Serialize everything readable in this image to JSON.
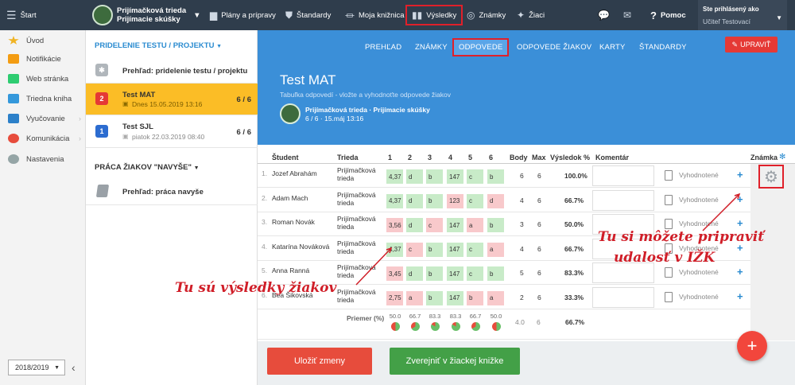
{
  "topbar": {
    "start": "Štart",
    "class_name": "Prijímačková trieda",
    "class_sub": "Prijímacie skúšky",
    "menu": [
      "Plány a prípravy",
      "Štandardy",
      "Moja knižnica",
      "Výsledky",
      "Známky",
      "Žiaci"
    ],
    "help": "Pomoc",
    "logged_label": "Ste prihlásený ako",
    "logged_user": "Učiteľ Testovací"
  },
  "sidebar": {
    "items": [
      {
        "label": "Úvod",
        "icon": "star-icon",
        "color": "#f0b323"
      },
      {
        "label": "Notifikácie",
        "icon": "mail-icon",
        "color": "#f39c12"
      },
      {
        "label": "Web stránka",
        "icon": "home-icon",
        "color": "#2ecc71"
      },
      {
        "label": "Triedna kniha",
        "icon": "book-icon",
        "color": "#3498db"
      },
      {
        "label": "Vyučovanie",
        "icon": "teach-icon",
        "color": "#2c80c9"
      },
      {
        "label": "Komunikácia",
        "icon": "chat-icon",
        "color": "#e74c3c"
      },
      {
        "label": "Nastavenia",
        "icon": "gear-icon",
        "color": "#95a5a6"
      }
    ],
    "year": "2018/2019"
  },
  "list": {
    "section1": "PRIDELENIE TESTU / PROJEKTU",
    "overview1": "Prehľad: pridelenie testu / projektu",
    "tests": [
      {
        "num": "2",
        "name": "Test MAT",
        "date": "Dnes 15.05.2019 13:16",
        "score": "6 / 6",
        "active": true
      },
      {
        "num": "1",
        "name": "Test SJL",
        "date": "piatok 22.03.2019 08:40",
        "score": "6 / 6",
        "active": false
      }
    ],
    "section2": "PRÁCA ŽIAKOV \"NAVYŠE\"",
    "overview2": "Prehľad: práca navyše"
  },
  "main": {
    "tabs": [
      "PREHĽAD",
      "ZNÁMKY",
      "ODPOVEDE",
      "ODPOVEDE ŽIAKOV",
      "KARTY",
      "ŠTANDARDY"
    ],
    "edit_btn": "UPRAVIŤ",
    "title": "Test MAT",
    "subtitle": "Tabuľka odpovedí - vložte a vyhodnoťte odpovede žiakov",
    "class_line": "Prijímačková trieda · Prijímacie skúšky",
    "class_date": "6 / 6 · 15.máj 13:16"
  },
  "table": {
    "headers": {
      "student": "Študent",
      "trieda": "Trieda",
      "q": [
        "1",
        "2",
        "3",
        "4",
        "5",
        "6"
      ],
      "body": "Body",
      "max": "Max",
      "result": "Výsledok %",
      "comment": "Komentár",
      "grade": "Známka"
    },
    "rows": [
      {
        "n": "1.",
        "name": "Jozef Abrahám",
        "trieda": "Prijímačková trieda",
        "ans": [
          [
            "4,37",
            "g"
          ],
          [
            "d",
            "g"
          ],
          [
            "b",
            "g"
          ],
          [
            "147",
            "g"
          ],
          [
            "c",
            "g"
          ],
          [
            "b",
            "g"
          ]
        ],
        "body": "6",
        "max": "6",
        "pct": "100.0%",
        "status": "Vyhodnotené"
      },
      {
        "n": "2.",
        "name": "Adam Mach",
        "trieda": "Prijímačková trieda",
        "ans": [
          [
            "4,37",
            "g"
          ],
          [
            "d",
            "g"
          ],
          [
            "b",
            "g"
          ],
          [
            "123",
            "r"
          ],
          [
            "c",
            "g"
          ],
          [
            "d",
            "r"
          ]
        ],
        "body": "4",
        "max": "6",
        "pct": "66.7%",
        "status": "Vyhodnotené"
      },
      {
        "n": "3.",
        "name": "Roman Novák",
        "trieda": "Prijímačková trieda",
        "ans": [
          [
            "3,56",
            "r"
          ],
          [
            "d",
            "g"
          ],
          [
            "c",
            "r"
          ],
          [
            "147",
            "g"
          ],
          [
            "a",
            "r"
          ],
          [
            "b",
            "g"
          ]
        ],
        "body": "3",
        "max": "6",
        "pct": "50.0%",
        "status": "Vyhodnotené"
      },
      {
        "n": "4.",
        "name": "Katarína Nováková",
        "trieda": "Prijímačková trieda",
        "ans": [
          [
            "4,37",
            "g"
          ],
          [
            "c",
            "r"
          ],
          [
            "b",
            "g"
          ],
          [
            "147",
            "g"
          ],
          [
            "c",
            "g"
          ],
          [
            "a",
            "r"
          ]
        ],
        "body": "4",
        "max": "6",
        "pct": "66.7%",
        "status": "Vyhodnotené"
      },
      {
        "n": "5.",
        "name": "Anna Ranná",
        "trieda": "Prijímačková trieda",
        "ans": [
          [
            "3,45",
            "r"
          ],
          [
            "d",
            "g"
          ],
          [
            "b",
            "g"
          ],
          [
            "147",
            "g"
          ],
          [
            "c",
            "g"
          ],
          [
            "b",
            "g"
          ]
        ],
        "body": "5",
        "max": "6",
        "pct": "83.3%",
        "status": "Vyhodnotené"
      },
      {
        "n": "6.",
        "name": "Bea Šikovská",
        "trieda": "Prijímačková trieda",
        "ans": [
          [
            "2,75",
            "r"
          ],
          [
            "a",
            "r"
          ],
          [
            "b",
            "g"
          ],
          [
            "147",
            "g"
          ],
          [
            "b",
            "r"
          ],
          [
            "a",
            "r"
          ]
        ],
        "body": "2",
        "max": "6",
        "pct": "33.3%",
        "status": "Vyhodnotené"
      }
    ],
    "avg_label": "Priemer (%)",
    "avg": [
      "50.0",
      "66.7",
      "83.3",
      "83.3",
      "66.7",
      "50.0"
    ],
    "avg_body": "4.0",
    "avg_max": "6",
    "avg_pct": "66.7%"
  },
  "buttons": {
    "save": "Uložiť zmeny",
    "publish": "Zverejniť v žiackej knižke",
    "fab": "+"
  },
  "annotations": {
    "left": "Tu sú výsledky žiakov",
    "right1": "Tu si môžete pripraviť",
    "right2": "udalosť v IŽK"
  }
}
